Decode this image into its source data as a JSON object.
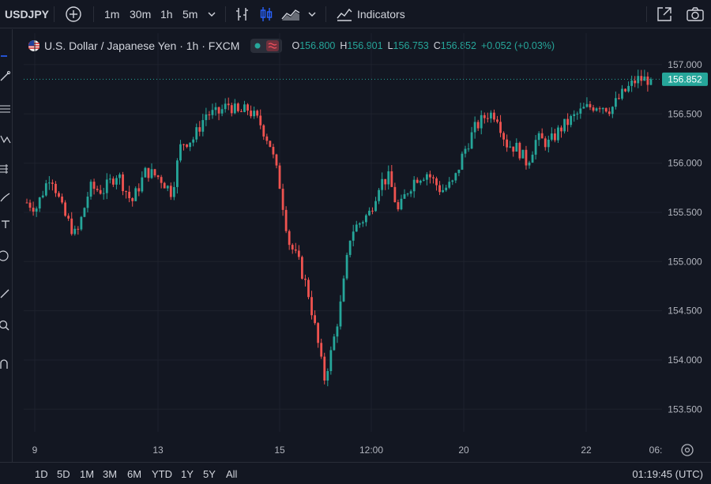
{
  "toolbar": {
    "symbol": "USDJPY",
    "timeframes": [
      {
        "label": "1m",
        "active": false
      },
      {
        "label": "30m",
        "active": false
      },
      {
        "label": "1h",
        "active": true
      },
      {
        "label": "5m",
        "active": false
      }
    ],
    "indicators_label": "Indicators"
  },
  "legend": {
    "title": "U.S. Dollar / Japanese Yen · 1h · FXCM",
    "o_label": "O",
    "o_value": "156.800",
    "h_label": "H",
    "h_value": "156.901",
    "l_label": "L",
    "l_value": "156.753",
    "c_label": "C",
    "c_value": "156.852",
    "change": "+0.052 (+0.03%)"
  },
  "bottom": {
    "ranges": [
      "1D",
      "5D",
      "1M",
      "3M",
      "6M",
      "YTD",
      "1Y",
      "5Y",
      "All"
    ],
    "clock": "01:19:45 (UTC)"
  },
  "colors": {
    "up": "#26a69a",
    "down": "#ef5350",
    "accent": "#2962ff",
    "background": "#131722"
  },
  "chart_data": {
    "type": "candlestick",
    "ylim": [
      153.35,
      157.2
    ],
    "y_ticks": [
      "157.000",
      "156.500",
      "156.000",
      "155.500",
      "155.000",
      "154.500",
      "154.000",
      "153.500"
    ],
    "x_ticks": [
      "9",
      "13",
      "15",
      "12:00",
      "20",
      "22",
      "06:"
    ],
    "last_price": "156.852",
    "close_path": [
      [
        0,
        155.6
      ],
      [
        10,
        155.55
      ],
      [
        25,
        155.9
      ],
      [
        38,
        155.5
      ],
      [
        52,
        155.25
      ],
      [
        66,
        155.75
      ],
      [
        80,
        155.72
      ],
      [
        95,
        155.9
      ],
      [
        110,
        155.6
      ],
      [
        125,
        155.92
      ],
      [
        140,
        155.85
      ],
      [
        152,
        155.7
      ],
      [
        162,
        156.2
      ],
      [
        175,
        156.25
      ],
      [
        188,
        156.5
      ],
      [
        200,
        156.5
      ],
      [
        212,
        156.6
      ],
      [
        222,
        156.5
      ],
      [
        232,
        156.55
      ],
      [
        245,
        156.4
      ],
      [
        255,
        156.2
      ],
      [
        265,
        155.8
      ],
      [
        275,
        155.2
      ],
      [
        285,
        155.0
      ],
      [
        295,
        154.7
      ],
      [
        305,
        154.2
      ],
      [
        312,
        153.8
      ],
      [
        320,
        154.1
      ],
      [
        330,
        154.6
      ],
      [
        340,
        155.3
      ],
      [
        350,
        155.4
      ],
      [
        360,
        155.5
      ],
      [
        370,
        155.8
      ],
      [
        380,
        155.85
      ],
      [
        390,
        155.5
      ],
      [
        398,
        155.7
      ],
      [
        408,
        155.85
      ],
      [
        420,
        155.9
      ],
      [
        435,
        155.72
      ],
      [
        448,
        155.8
      ],
      [
        458,
        156.1
      ],
      [
        470,
        156.35
      ],
      [
        483,
        156.5
      ],
      [
        493,
        156.5
      ],
      [
        503,
        156.2
      ],
      [
        515,
        156.15
      ],
      [
        525,
        156.0
      ],
      [
        535,
        156.25
      ],
      [
        548,
        156.2
      ],
      [
        560,
        156.35
      ],
      [
        572,
        156.45
      ],
      [
        585,
        156.55
      ],
      [
        600,
        156.6
      ],
      [
        613,
        156.55
      ],
      [
        625,
        156.7
      ],
      [
        640,
        156.85
      ],
      [
        655,
        156.852
      ]
    ]
  }
}
